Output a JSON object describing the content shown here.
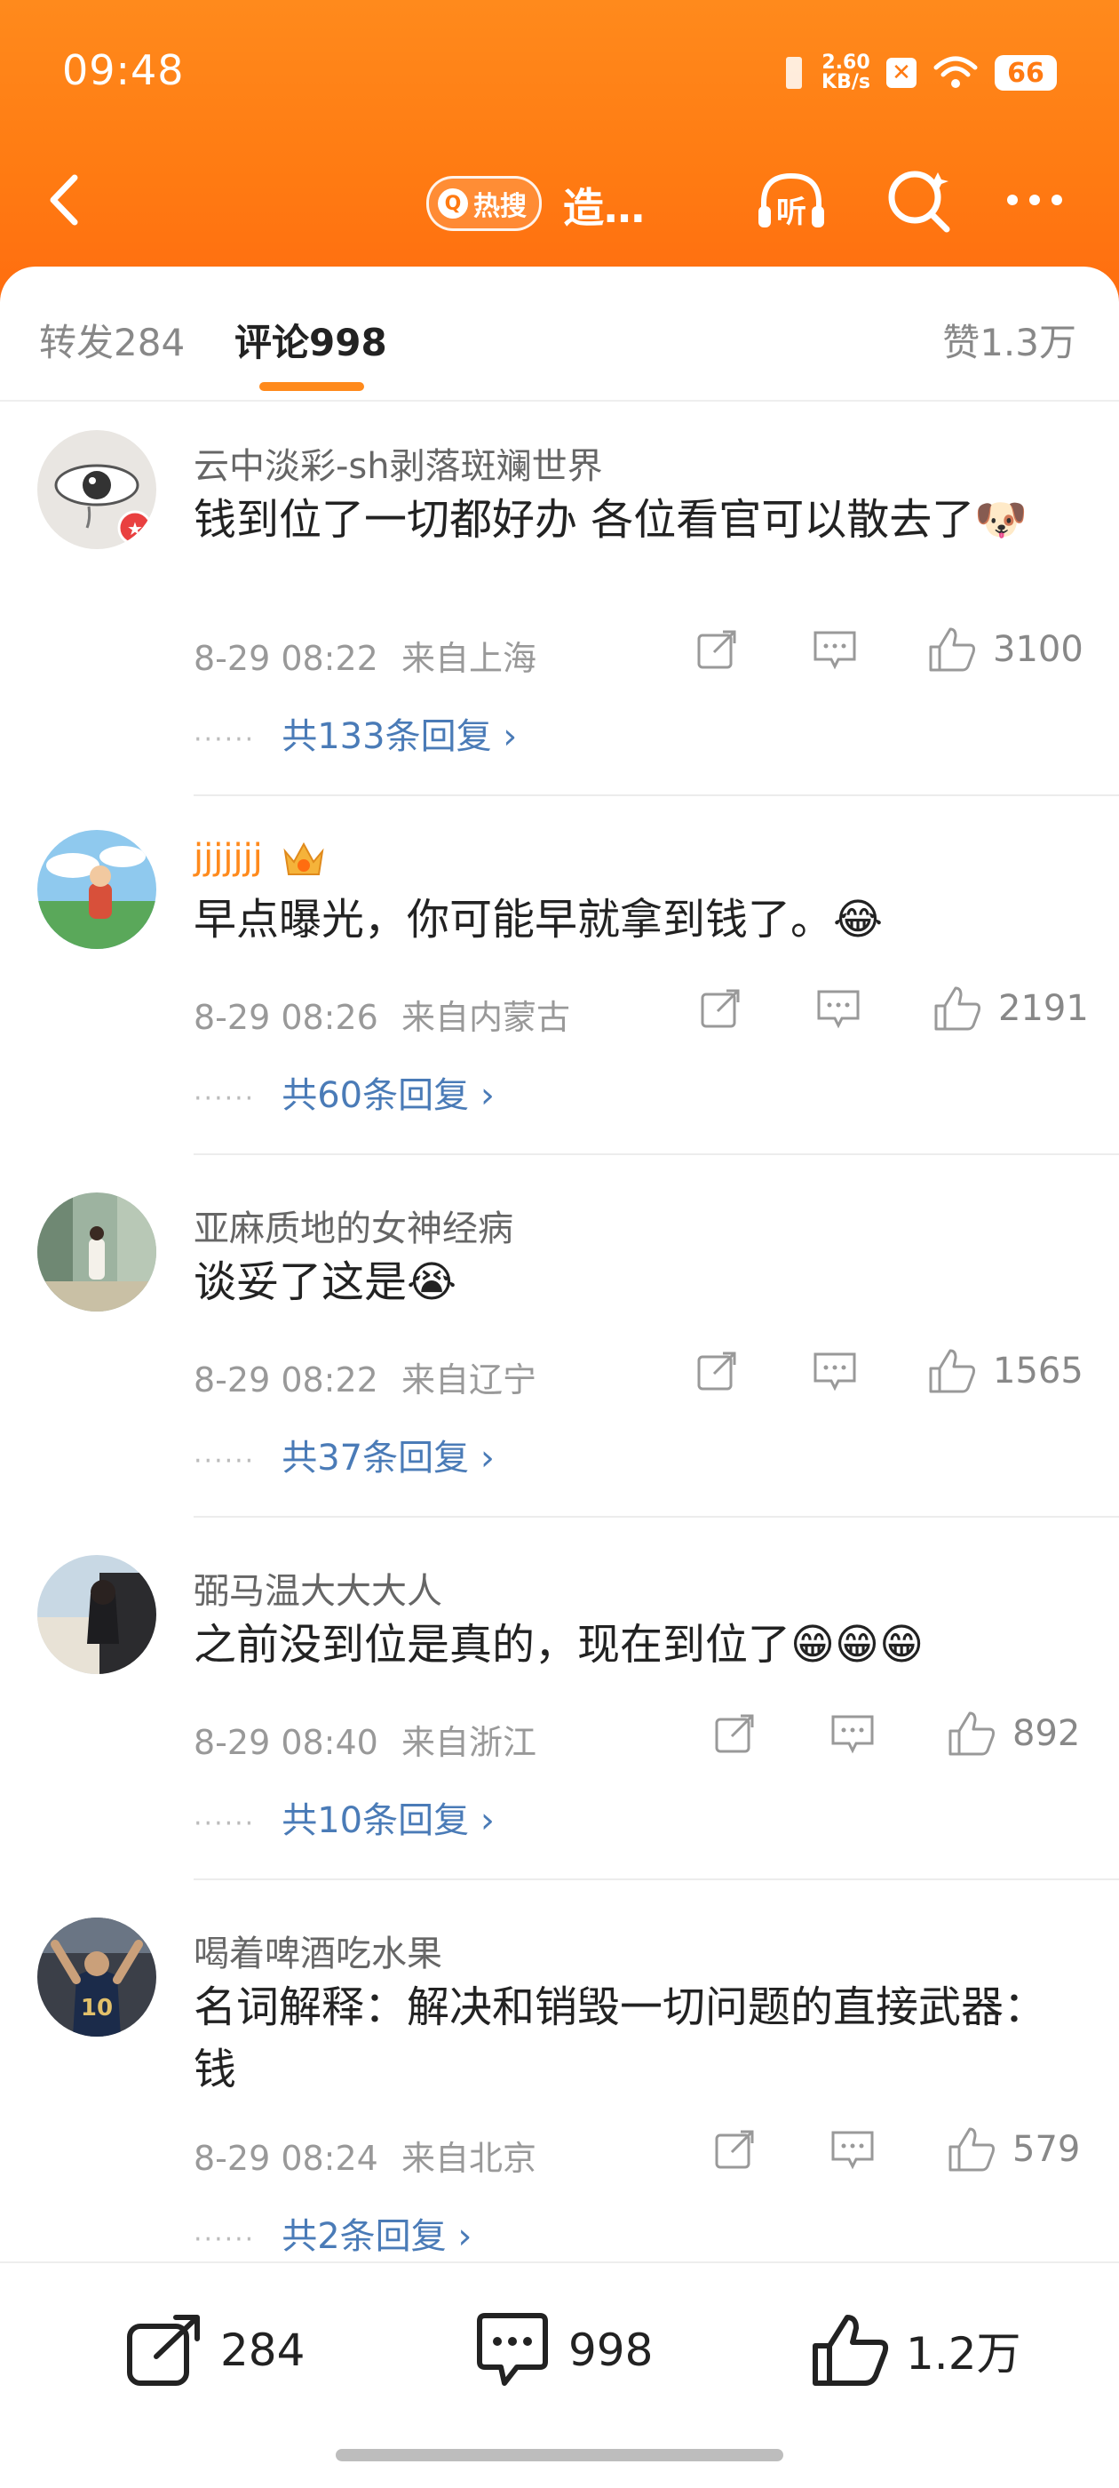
{
  "status": {
    "time": "09:48",
    "net_speed": "2.60",
    "net_unit": "KB/s",
    "battery": "66"
  },
  "nav": {
    "hot_label": "热搜",
    "title": "造…",
    "listen_label": "听"
  },
  "tabs": {
    "repost": "转发284",
    "comment": "评论998",
    "likes": "赞1.3万"
  },
  "comments": [
    {
      "user": "云中淡彩-sh剥落斑斓世界",
      "text": "钱到位了一切都好办 各位看官可以散去了🐶",
      "time": "8-29 08:22",
      "location": "来自上海",
      "likes": "3100",
      "replies": "共133条回复"
    },
    {
      "user": "jjjjjjj",
      "text": "早点曝光，你可能早就拿到钱了。😂",
      "time": "8-29 08:26",
      "location": "来自内蒙古",
      "likes": "2191",
      "replies": "共60条回复"
    },
    {
      "user": "亚麻质地的女神经病",
      "text": "谈妥了这是😭",
      "time": "8-29 08:22",
      "location": "来自辽宁",
      "likes": "1565",
      "replies": "共37条回复"
    },
    {
      "user": "弼马温大大大人",
      "text": "之前没到位是真的，现在到位了😁😁😁",
      "time": "8-29 08:40",
      "location": "来自浙江",
      "likes": "892",
      "replies": "共10条回复"
    },
    {
      "user": "喝着啤酒吃水果",
      "text": "名词解释：解决和销毁一切问题的直接武器：钱",
      "time": "8-29 08:24",
      "location": "来自北京",
      "likes": "579",
      "replies": "共2条回复"
    }
  ],
  "bottom": {
    "repost": "284",
    "comment": "998",
    "like": "1.2万"
  },
  "colors": {
    "accent": "#ff7a12",
    "link": "#4a7bb7",
    "vip_name": "#ff8a1c"
  }
}
